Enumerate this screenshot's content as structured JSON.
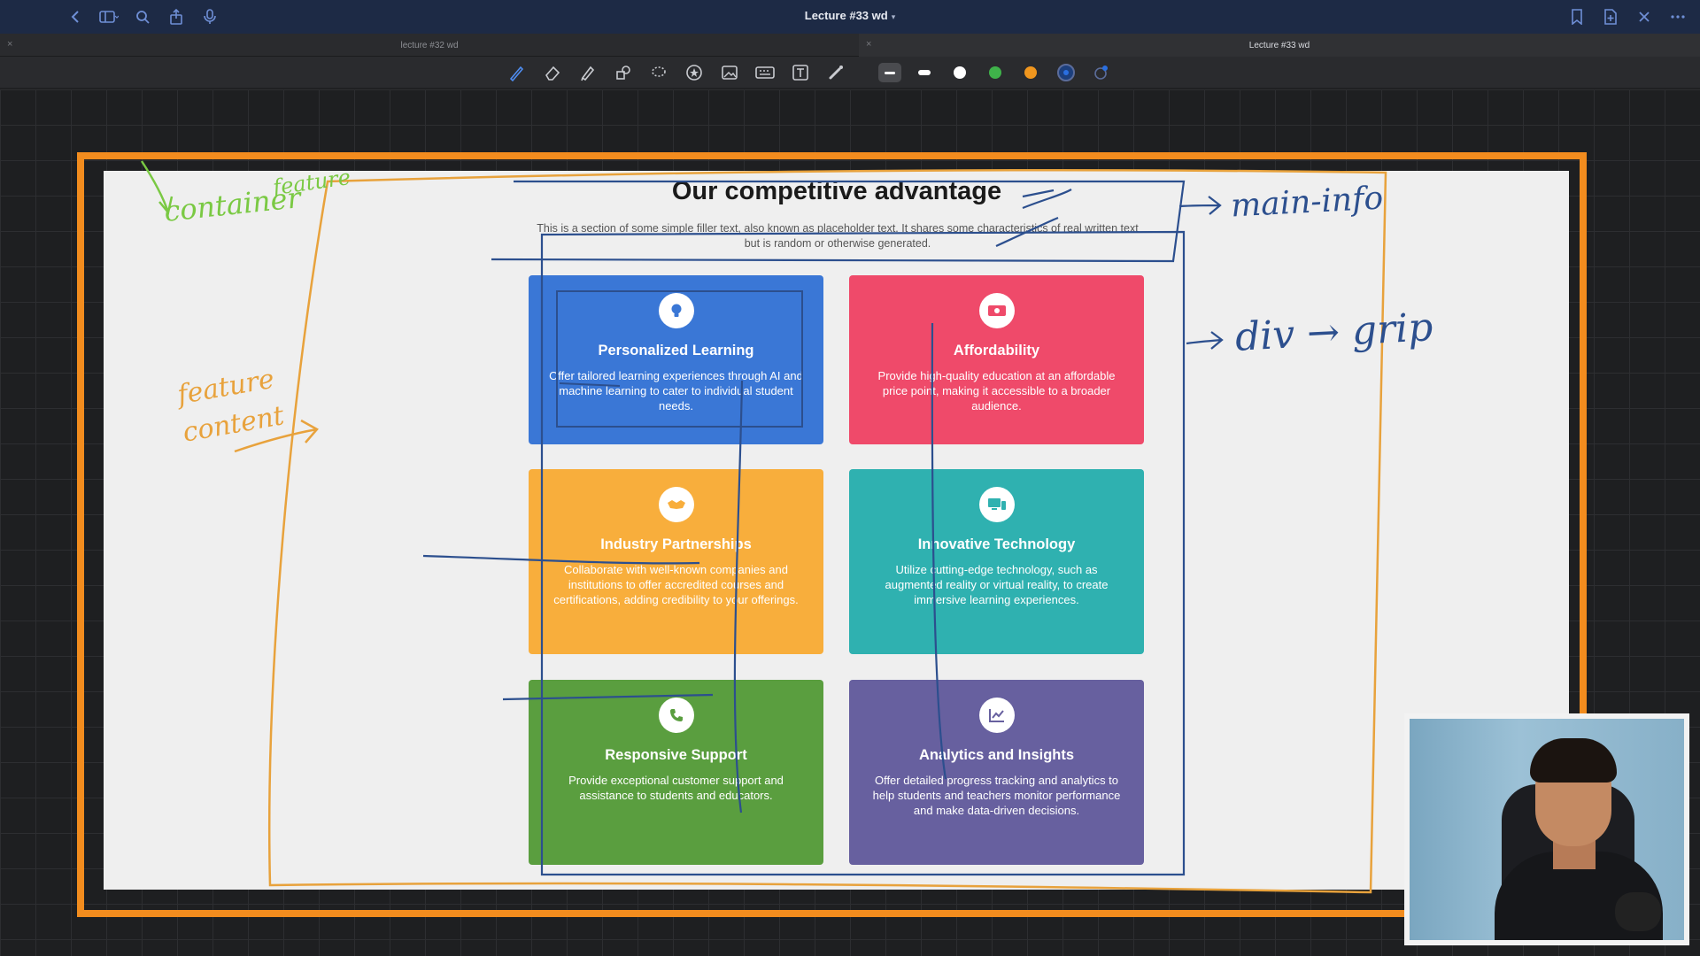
{
  "app": {
    "window_title": "Lecture #33 wd",
    "tabs": [
      {
        "label": "lecture #32 wd",
        "active": false
      },
      {
        "label": "Lecture #33 wd",
        "active": true
      }
    ],
    "toolbar": {
      "tools": [
        "pen-icon",
        "eraser-icon",
        "highlighter-icon",
        "shapes-icon",
        "lasso-icon",
        "sticker-icon",
        "image-icon",
        "keyboard-icon",
        "text-box-icon",
        "laser-pointer-icon"
      ],
      "colors": [
        "#ffffff",
        "#ffffff",
        "#3fb24a",
        "#f0961e",
        "#1c3f7d"
      ],
      "accent": "#4f8df0"
    }
  },
  "webpage": {
    "title": "Our competitive advantage",
    "subtitle": "This is a section of some simple filler text, also known as placeholder text. It shares some characteristics of real written text but is random or otherwise generated.",
    "features": [
      {
        "title": "Personalized Learning",
        "text": "Offer tailored learning experiences through AI and machine learning to cater to individual student needs.",
        "icon": "lightbulb-icon",
        "color": "#3a77d6"
      },
      {
        "title": "Affordability",
        "text": "Provide high-quality education at an affordable price point, making it accessible to a broader audience.",
        "icon": "money-icon",
        "color": "#ef4a6a"
      },
      {
        "title": "Industry Partnerships",
        "text": "Collaborate with well-known companies and institutions to offer accredited courses and certifications, adding credibility to your offerings.",
        "icon": "handshake-icon",
        "color": "#f8ae3c"
      },
      {
        "title": "Innovative Technology",
        "text": "Utilize cutting-edge technology, such as augmented reality or virtual reality, to create immersive learning experiences.",
        "icon": "devices-icon",
        "color": "#2fb1b0"
      },
      {
        "title": "Responsive Support",
        "text": "Provide exceptional customer support and assistance to students and educators.",
        "icon": "phone-icon",
        "color": "#5a9e3f"
      },
      {
        "title": "Analytics and Insights",
        "text": "Offer detailed progress tracking and analytics to help students and teachers monitor performance and make data-driven decisions.",
        "icon": "chart-icon",
        "color": "#67609f"
      }
    ]
  },
  "annotations": {
    "container_label": "container",
    "feature_label": "feature",
    "feature_content_label_1": "feature",
    "feature_content_label_2": "content",
    "main_info_label": "main-info",
    "div_grid_label": "div → grip"
  }
}
